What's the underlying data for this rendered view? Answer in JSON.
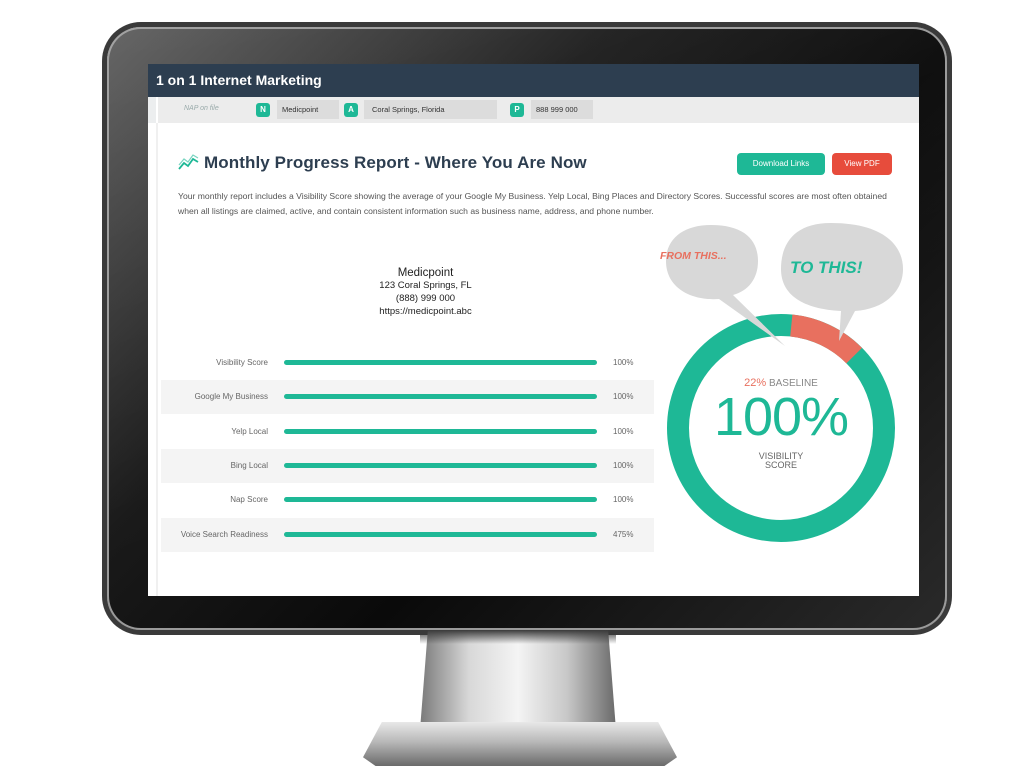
{
  "header": {
    "title": "1 on 1 Internet Marketing"
  },
  "nap": {
    "label": "NAP on file",
    "fields": [
      {
        "badge": "N",
        "value": "Medicpoint"
      },
      {
        "badge": "A",
        "value": "Coral Springs, Florida"
      },
      {
        "badge": "P",
        "value": "888 999 000"
      }
    ]
  },
  "report": {
    "title": "Monthly Progress Report - Where You Are Now",
    "download_label": "Download Links",
    "pdf_label": "View PDF",
    "description": "Your monthly report includes a Visibility Score showing the average of your Google My Business. Yelp Local, Bing Places and Directory Scores. Successful scores are most often obtained when all listings are claimed, active, and contain consistent information such as business name, address, and phone number."
  },
  "business": {
    "name": "Medicpoint",
    "address": "123 Coral Springs, FL",
    "phone": "(888) 999 000",
    "url": "https://medicpoint.abc"
  },
  "scores": [
    {
      "label": "Visibility Score",
      "value": "100%",
      "fill": 1.0
    },
    {
      "label": "Google My Business",
      "value": "100%",
      "fill": 1.0
    },
    {
      "label": "Yelp Local",
      "value": "100%",
      "fill": 1.0
    },
    {
      "label": "Bing Local",
      "value": "100%",
      "fill": 1.0
    },
    {
      "label": "Nap Score",
      "value": "100%",
      "fill": 1.0
    },
    {
      "label": "Voice Search Readiness",
      "value": "475%",
      "fill": 1.0
    }
  ],
  "gauge": {
    "baseline_pct": "22%",
    "baseline_label": "BASELINE",
    "score": "100%",
    "score_label_1": "VISIBILITY",
    "score_label_2": "SCORE",
    "baseline_fraction": 0.22,
    "score_fraction": 1.0
  },
  "callouts": {
    "from": "FROM THIS...",
    "to": "TO THIS!"
  },
  "colors": {
    "accent": "#1eb896",
    "danger": "#e74c3c",
    "header": "#2d3e50",
    "baseline": "#e8705f"
  }
}
